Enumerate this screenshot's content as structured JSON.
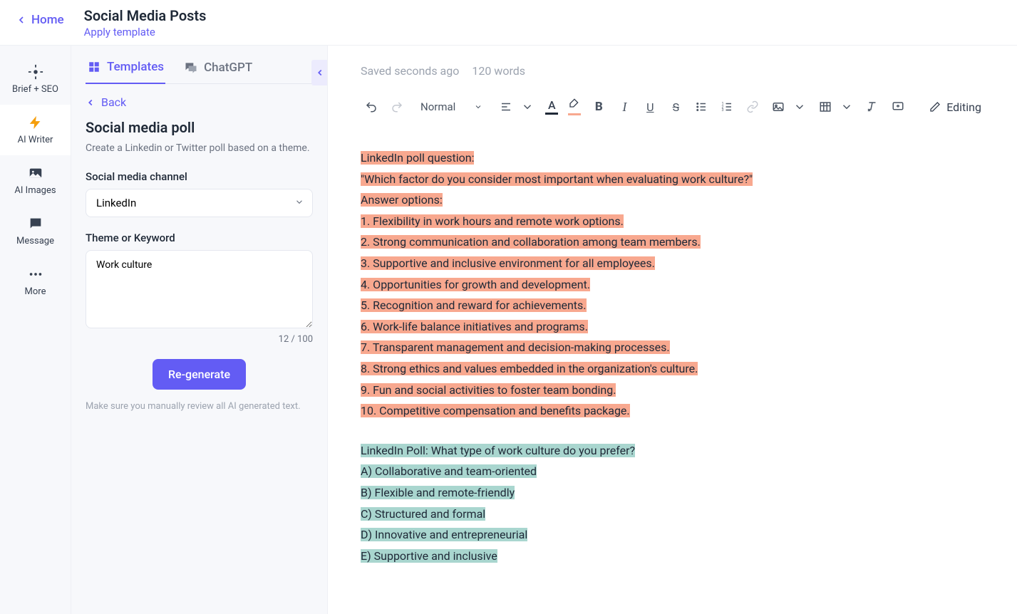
{
  "header": {
    "home": "Home",
    "title": "Social Media Posts",
    "apply_template": "Apply template"
  },
  "leftnav": {
    "brief": "Brief + SEO",
    "writer": "AI Writer",
    "images": "AI Images",
    "message": "Message",
    "more": "More"
  },
  "panel": {
    "tab_templates": "Templates",
    "tab_chatgpt": "ChatGPT",
    "back": "Back",
    "title": "Social media poll",
    "desc": "Create a Linkedin or Twitter poll based on a theme.",
    "field_channel": "Social media channel",
    "channel_value": "LinkedIn",
    "field_theme": "Theme or Keyword",
    "theme_value": "Work culture",
    "char_count": "12 / 100",
    "regenerate": "Re-generate",
    "note": "Make sure you manually review all AI generated text."
  },
  "editor": {
    "saved": "Saved seconds ago",
    "words": "120 words",
    "format": "Normal",
    "editing": "Editing",
    "text_color": "#1f2937",
    "highlight_color": "#f8a88f",
    "salmon": [
      "LinkedIn poll question:",
      "\"Which factor do you consider most important when evaluating work culture?\"",
      "Answer options:",
      "1. Flexibility in work hours and remote work options.",
      "2. Strong communication and collaboration among team members.",
      "3. Supportive and inclusive environment for all employees.",
      "4. Opportunities for growth and development.",
      "5. Recognition and reward for achievements.",
      "6. Work-life balance initiatives and programs.",
      "7. Transparent management and decision-making processes.",
      "8. Strong ethics and values embedded in the organization's culture.",
      "9. Fun and social activities to foster team bonding.",
      "10. Competitive compensation and benefits package."
    ],
    "teal": [
      "LinkedIn Poll: What type of work culture do you prefer?",
      "A) Collaborative and team-oriented",
      "B) Flexible and remote-friendly",
      "C) Structured and formal",
      "D) Innovative and entrepreneurial",
      "E) Supportive and inclusive"
    ]
  }
}
